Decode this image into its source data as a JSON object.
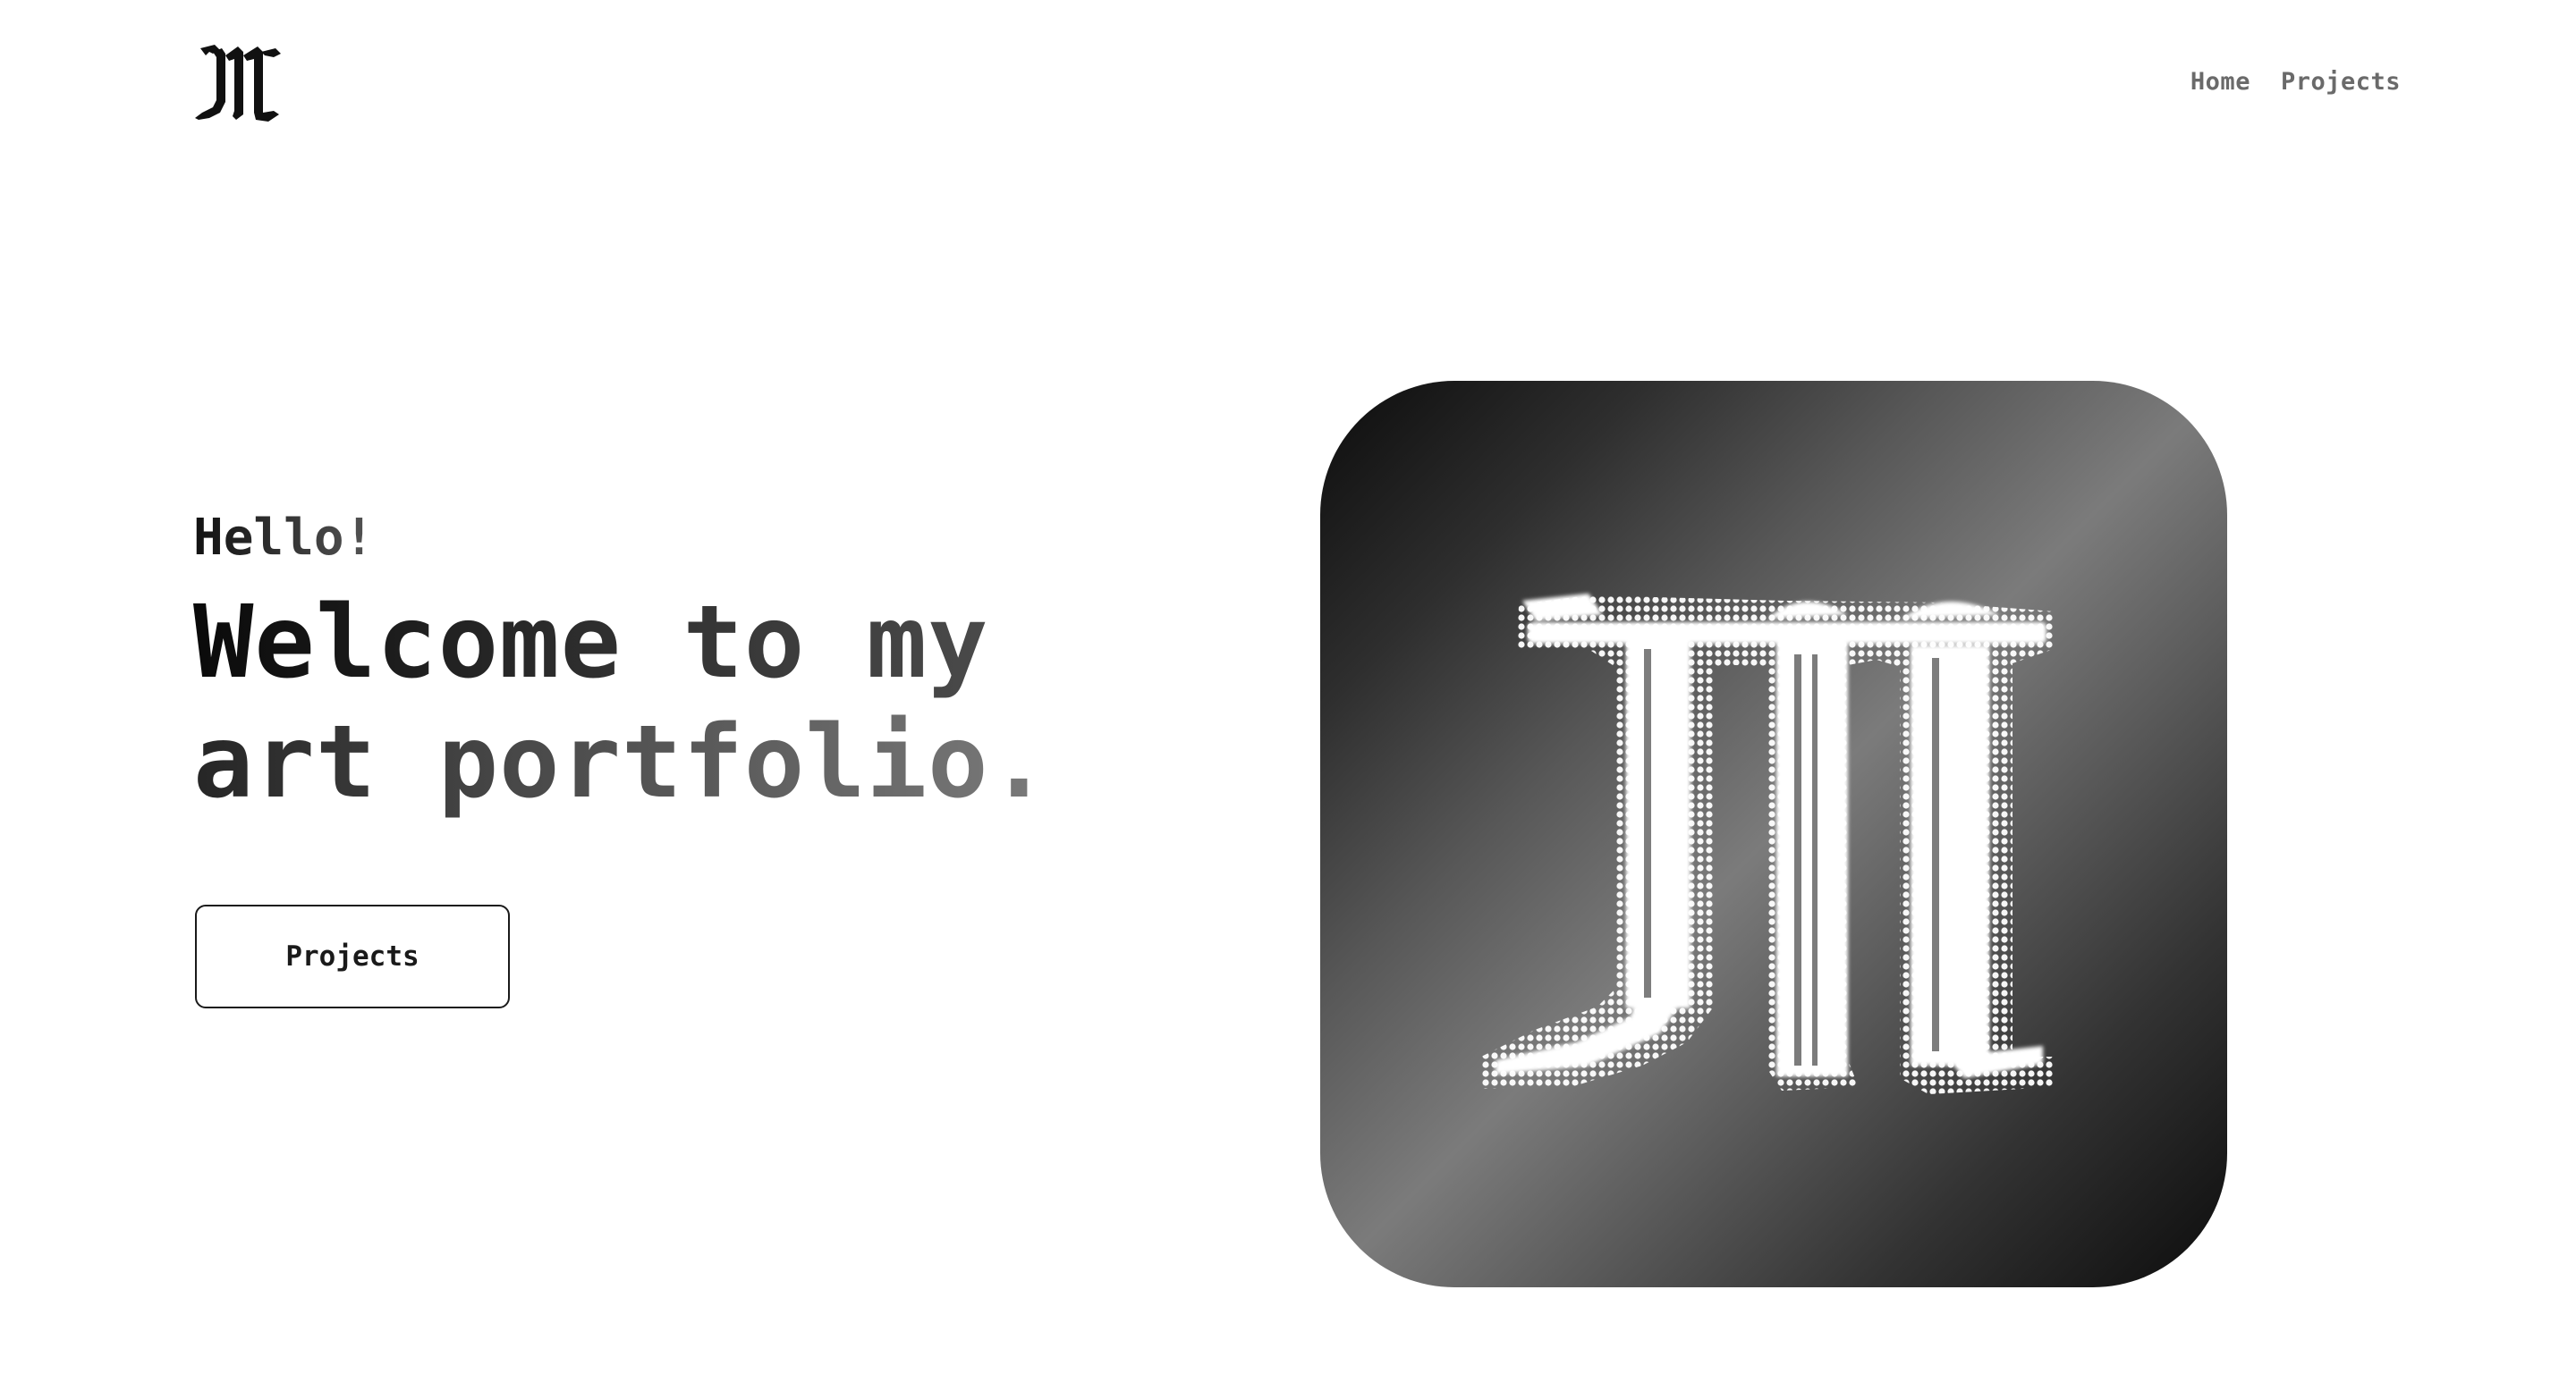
{
  "header": {
    "logo_glyph": "M",
    "nav": [
      {
        "label": "Home"
      },
      {
        "label": "Projects"
      }
    ]
  },
  "hero": {
    "greeting": "Hello!",
    "headline_line1": "Welcome to my",
    "headline_line2": "art portfolio.",
    "cta_label": "Projects",
    "image_glyph": "M"
  },
  "colors": {
    "text_dark": "#111111",
    "nav_gray": "#6a6a6a",
    "card_dark": "#0c0c0c",
    "card_light": "#7b7b7b"
  },
  "icons": {
    "logo": "blackletter-m-logo-icon",
    "hero_image": "halftone-m-artwork"
  }
}
